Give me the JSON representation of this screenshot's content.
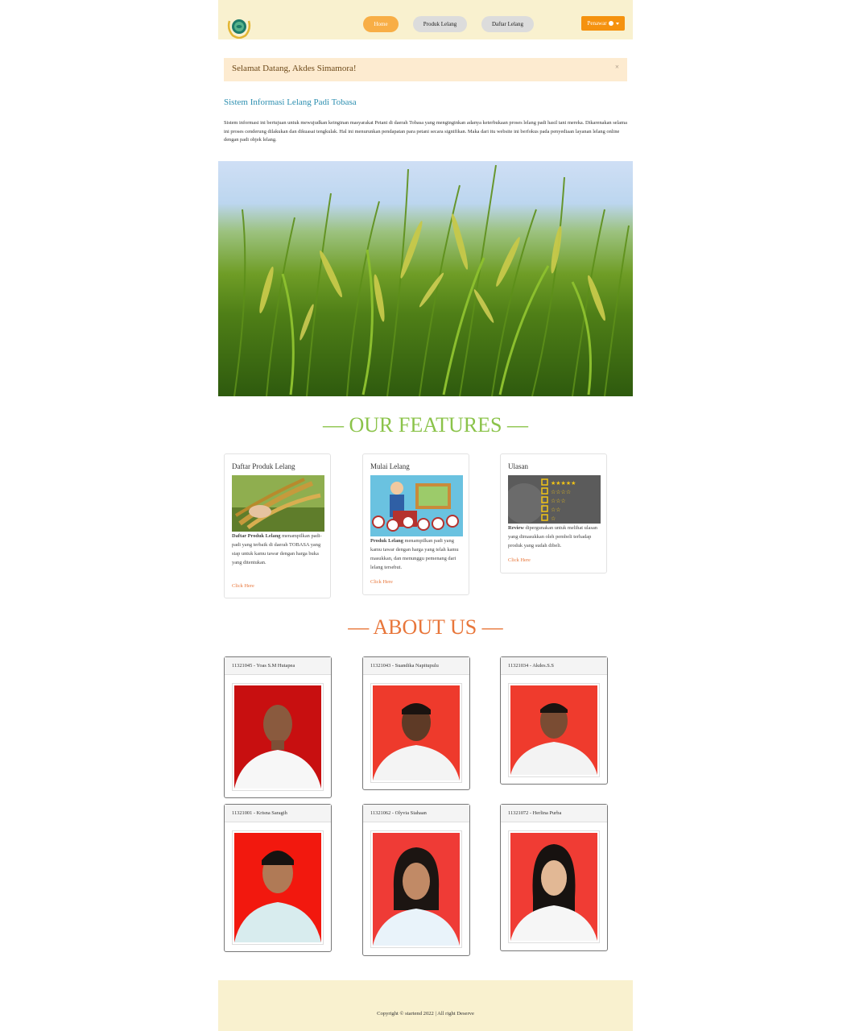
{
  "navbar": {
    "logo_icon": "leaf-emblem-logo",
    "home_label": "Home",
    "produk_label": "Produk Lelang",
    "daftar_label": "Daftar Lelang",
    "user_label": "Penawar",
    "user_icon": "user-circle-icon",
    "colors": {
      "bar": "#f9f1cf",
      "active": "#f8ae46",
      "user": "#f5920f"
    }
  },
  "alert": {
    "message": "Selamat Datang, Akdes Simamora!",
    "close": "×"
  },
  "intro": {
    "title": "Sistem Informasi Lelang Padi Tobasa",
    "text": "Sistem informasi ini bertujuan untuk mewujudkan keinginan masyarakat Petani di daerah Tobasa yang menginginkan adanya keterbukaan proses lelang padi hasil tani mereka. Dikarenakan selama ini proses cenderung dilakukan dan dikuasai tengkulak. Hal ini menurunkan pendapatan para petani secara signifikan. Maka dari itu website ini berfokus pada penyediaan layanan lelang online dengan padi objek lelang."
  },
  "features": {
    "title": "— OUR FEATURES —",
    "cards": [
      {
        "title": "Daftar Produk Lelang",
        "bold": "Daftar Produk Lelang",
        "desc": " menampilkan padi-padi yang terbaik di daerah TOBASA yang siap untuk kamu tawar dengan harga buka yang ditentukan.",
        "link": "Click Here"
      },
      {
        "title": "Mulai Lelang",
        "bold": "Produk Lelang",
        "desc": " menampilkan padi yang kamu tawar dengan harga yang telah kamu masukkan, dan menunggu pemenang dari lelang tersebut.",
        "link": "Click Here"
      },
      {
        "title": "Ulasan",
        "bold": "Review",
        "desc": " dipergunakan untuk melihat ulasan yang dimasukkan oleh pembeli terhadap produk yang sudah dibeli.",
        "link": "Click Here"
      }
    ]
  },
  "about": {
    "title": "— ABOUT US —",
    "members": [
      {
        "label": "11321045 - Yoas S.M Hutapea"
      },
      {
        "label": "11321043 - Suandika Napitupulu"
      },
      {
        "label": "11321034 - Akdes.S.S"
      },
      {
        "label": "11321001 - Krisna Saragih"
      },
      {
        "label": "11321062 - Olyvia Siahaan"
      },
      {
        "label": "11321072 - Herlina Purba"
      }
    ]
  },
  "footer": {
    "text": "Copyright © startend 2022 | All right Deserve"
  }
}
